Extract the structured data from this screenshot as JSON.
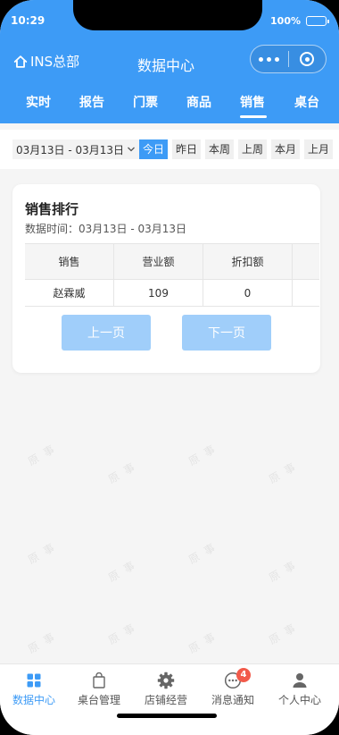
{
  "status_bar": {
    "time": "10:29",
    "battery": "100%"
  },
  "header": {
    "home_label": "INS总部",
    "title": "数据中心"
  },
  "tabs": [
    {
      "label": "实时",
      "active": false
    },
    {
      "label": "报告",
      "active": false
    },
    {
      "label": "门票",
      "active": false
    },
    {
      "label": "商品",
      "active": false
    },
    {
      "label": "销售",
      "active": true
    },
    {
      "label": "桌台",
      "active": false
    }
  ],
  "filter": {
    "date_range": "03月13日 - 03月13日",
    "chips": [
      {
        "label": "今日",
        "active": true
      },
      {
        "label": "昨日",
        "active": false
      },
      {
        "label": "本周",
        "active": false
      },
      {
        "label": "上周",
        "active": false
      },
      {
        "label": "本月",
        "active": false
      },
      {
        "label": "上月",
        "active": false
      }
    ]
  },
  "card": {
    "title": "销售排行",
    "subtitle": "数据时间：03月13日 - 03月13日",
    "columns": [
      "销售",
      "营业额",
      "折扣额"
    ],
    "rows": [
      [
        "赵霖威",
        "109",
        "0"
      ]
    ],
    "prev_label": "上一页",
    "next_label": "下一页"
  },
  "watermark": "原 事",
  "tabbar": [
    {
      "label": "数据中心",
      "icon": "grid-icon",
      "active": true
    },
    {
      "label": "桌台管理",
      "icon": "bag-icon",
      "active": false
    },
    {
      "label": "店铺经营",
      "icon": "gear-icon",
      "active": false
    },
    {
      "label": "消息通知",
      "icon": "chat-icon",
      "active": false,
      "badge": "4"
    },
    {
      "label": "个人中心",
      "icon": "person-icon",
      "active": false
    }
  ],
  "colors": {
    "primary": "#3d9bf6",
    "button_disabled": "#a0cefa",
    "badge": "#f25a4a"
  }
}
